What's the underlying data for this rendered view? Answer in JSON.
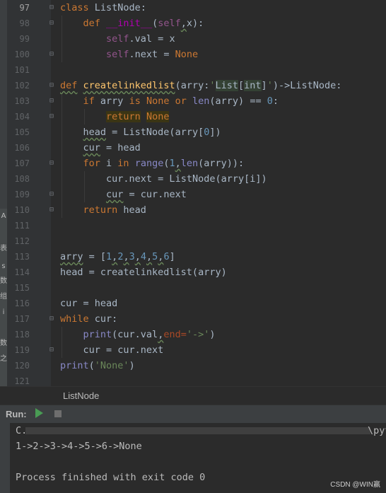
{
  "editor": {
    "line_numbers": [
      "97",
      "98",
      "99",
      "100",
      "101",
      "102",
      "103",
      "104",
      "105",
      "106",
      "107",
      "108",
      "109",
      "110",
      "111",
      "112",
      "113",
      "114",
      "115",
      "116",
      "117",
      "118",
      "119",
      "120",
      "121"
    ],
    "current_line": "97",
    "lines": [
      {
        "n": "97",
        "code": "class ListNode:"
      },
      {
        "n": "98",
        "code": "    def __init__(self,x):"
      },
      {
        "n": "99",
        "code": "        self.val = x"
      },
      {
        "n": "100",
        "code": "        self.next = None"
      },
      {
        "n": "101",
        "code": ""
      },
      {
        "n": "102",
        "code": "def createlinkedlist(arry:'List[int]')->ListNode:"
      },
      {
        "n": "103",
        "code": "    if arry is None or len(arry) == 0:"
      },
      {
        "n": "104",
        "code": "        return None"
      },
      {
        "n": "105",
        "code": "    head = ListNode(arry[0])"
      },
      {
        "n": "106",
        "code": "    cur = head"
      },
      {
        "n": "107",
        "code": "    for i in range(1,len(arry)):"
      },
      {
        "n": "108",
        "code": "        cur.next = ListNode(arry[i])"
      },
      {
        "n": "109",
        "code": "        cur = cur.next"
      },
      {
        "n": "110",
        "code": "    return head"
      },
      {
        "n": "111",
        "code": ""
      },
      {
        "n": "112",
        "code": ""
      },
      {
        "n": "113",
        "code": "arry = [1,2,3,4,5,6]"
      },
      {
        "n": "114",
        "code": "head = createlinkedlist(arry)"
      },
      {
        "n": "115",
        "code": ""
      },
      {
        "n": "116",
        "code": "cur = head"
      },
      {
        "n": "117",
        "code": "while cur:"
      },
      {
        "n": "118",
        "code": "    print(cur.val,end='->')"
      },
      {
        "n": "119",
        "code": "    cur = cur.next"
      },
      {
        "n": "120",
        "code": "print('None')"
      },
      {
        "n": "121",
        "code": ""
      }
    ],
    "tokens": {
      "class": "class",
      "class_name": " ListNode:",
      "def": "def",
      "init": "__init__",
      "self": "self",
      "x": "x):",
      "self_val": "self",
      "val_rest": ".val = x",
      "self_next": "self",
      "next_rest": ".next = ",
      "none": "None",
      "def2": "def",
      "func": "createlinkedlist",
      "param": "(arry:",
      "q1": "'",
      "list_t": "List",
      "lb": "[",
      "int_t": "int",
      "rb": "]",
      "q2": "'",
      "ret_t": ")->ListNode:",
      "if": "if",
      "arry1": " arry ",
      "is": "is",
      "none1": "None",
      "or": "or",
      "len1": "len",
      "arr_eq": "(arry) == ",
      "zero": "0",
      "colon": ":",
      "return1": "return",
      "none2": "None",
      "head_asg": "head",
      "head_rest": " = ListNode(arry[",
      "zero2": "0",
      "head_end": "])",
      "cur_asg": "cur",
      "cur_rest": " = head",
      "for": "for",
      "i_in": " i ",
      "in": "in",
      "range": "range",
      "lp": "(",
      "one": "1",
      "comma": ",",
      "len2": "len",
      "for_end": "(arry)):",
      "cn_asg": "cur.next = ListNode(arry[i])",
      "cur2": "cur",
      "cur2_rest": " = cur.next",
      "return2": "return",
      "ret_head": " head",
      "arry_var": "arry",
      "arry_eq": " = [",
      "n1": "1",
      "n2": "2",
      "n3": "3",
      "n4": "4",
      "n5": "5",
      "n6": "6",
      "c": ",",
      "arr_end": "]",
      "head_call": "head = createlinkedlist(arry)",
      "cur_head": "cur = head",
      "while": "while",
      "while_rest": " cur:",
      "print1": "print",
      "print1_a": "(cur.val",
      "print1_b": "end=",
      "arrow": "'->'",
      "print1_c": ")",
      "cur_next": "cur = cur.next",
      "print2": "print",
      "print2_a": "(",
      "none_str": "'None'",
      "print2_b": ")"
    }
  },
  "breadcrumb": {
    "label": "ListNode"
  },
  "run": {
    "label": "Run:",
    "console_lines": [
      "C.",
      "1->2->3->4->5->6->None",
      "",
      "Process finished with exit code 0"
    ],
    "path_tail": "\\pyt"
  },
  "left_strip_chars": [
    "A",
    "表",
    "s",
    "数",
    "组",
    "i",
    "数",
    "之",
    "C"
  ],
  "watermark": "CSDN @WIN赢"
}
